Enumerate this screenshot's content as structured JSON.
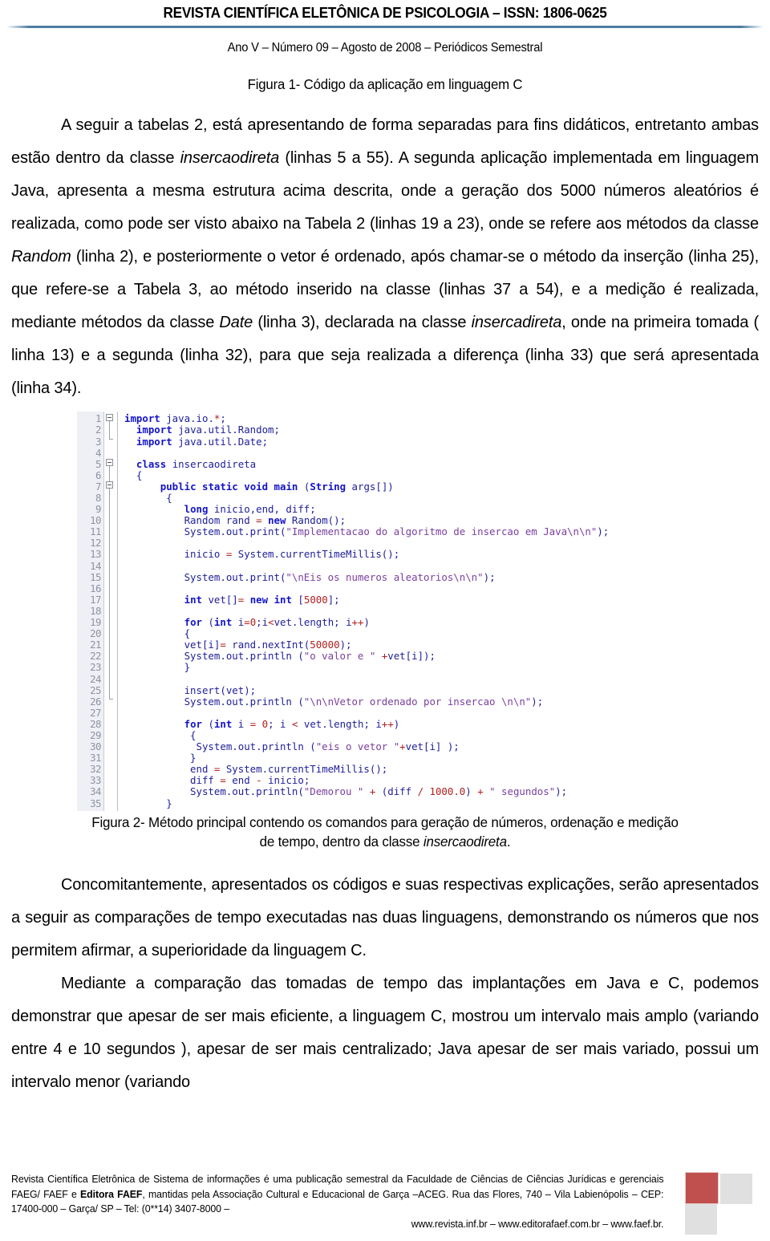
{
  "header": {
    "title": "REVISTA CIENTÍFICA ELETÔNICA DE PSICOLOGIA – ISSN: 1806-0625",
    "subtitle": "Ano V – Número 09 – Agosto  de 2008 – Periódicos Semestral",
    "rule_color": "#4c7ea1"
  },
  "figure1": {
    "caption": "Figura 1- Código da aplicação em linguagem C"
  },
  "paragraphs": {
    "p1_a": "A seguir a tabelas 2, está apresentando de forma separadas para fins didáticos, entretanto ambas estão dentro da classe ",
    "p1_i1": "insercaodireta",
    "p1_b": " (linhas 5 a 55). A segunda aplicação implementada em linguagem Java, apresenta a mesma estrutura acima descrita, onde a geração dos 5000 números aleatórios é realizada, como pode ser visto abaixo na Tabela 2  (linhas 19 a 23), onde se refere aos métodos da classe ",
    "p1_i2": "Random",
    "p1_c": " (linha 2), e posteriormente o vetor é ordenado, após chamar-se o método da inserção (linha 25), que refere-se a Tabela 3, ao método inserido na classe (linhas 37 a 54), e a medição é realizada, mediante métodos da classe ",
    "p1_i3": "Date",
    "p1_d": " (linha 3), declarada na classe ",
    "p1_i4": "insercadireta",
    "p1_e": ", onde na primeira tomada ( linha 13) e a segunda   (linha 32), para que seja realizada a diferença (linha 33)  que será apresentada (linha 34).",
    "p2": "Concomitantemente, apresentados os códigos e suas respectivas explicações, serão apresentados a seguir as comparações de tempo executadas nas duas linguagens, demonstrando os números que nos permitem afirmar, a superioridade da linguagem C.",
    "p3": "Mediante a comparação das tomadas de tempo das implantações em Java e C, podemos demonstrar que apesar de ser mais eficiente, a linguagem C, mostrou um intervalo mais amplo (variando entre 4 e 10 segundos ), apesar de ser mais centralizado; Java apesar de ser mais variado, possui um intervalo menor (variando"
  },
  "code": {
    "language": "java",
    "first_line": 1,
    "last_line": 35,
    "line_numbers": [
      "1",
      "2",
      "3",
      "4",
      "5",
      "6",
      "7",
      "8",
      "9",
      "10",
      "11",
      "12",
      "13",
      "14",
      "15",
      "16",
      "17",
      "18",
      "19",
      "20",
      "21",
      "22",
      "23",
      "24",
      "25",
      "26",
      "27",
      "28",
      "29",
      "30",
      "31",
      "32",
      "33",
      "34",
      "35"
    ],
    "lines": [
      "import java.io.*;",
      "  import java.util.Random;",
      "  import java.util.Date;",
      "",
      "  class insercaodireta",
      "  {",
      "      public static void main (String args[])",
      "       {",
      "          long inicio,end, diff;",
      "          Random rand = new Random();",
      "          System.out.print(\"Implementacao do algoritmo de insercao em Java\\n\\n\");",
      "",
      "          inicio = System.currentTimeMillis();",
      "",
      "          System.out.print(\"\\nEis os numeros aleatorios\\n\\n\");",
      "",
      "          int vet[]= new int [5000];",
      "",
      "          for (int i=0;i<vet.length; i++)",
      "          {",
      "          vet[i]= rand.nextInt(50000);",
      "          System.out.println (\"o valor e \" +vet[i]);",
      "          }",
      "",
      "          insert(vet);",
      "          System.out.println (\"\\n\\nVetor ordenado por insercao \\n\\n\");",
      "",
      "          for (int i = 0; i < vet.length; i++)",
      "           {",
      "            System.out.println (\"eis o vetor \"+vet[i] );",
      "           }",
      "           end = System.currentTimeMillis();",
      "           diff = end - inicio;",
      "           System.out.println(\"Demorou \" + (diff / 1000.0) + \" segundos\");",
      "       }"
    ]
  },
  "figure2": {
    "caption_line1": "Figura 2- Método principal contendo os comandos para geração de números, ordenação e medição",
    "caption_line2_a": "de tempo, dentro da classe ",
    "caption_line2_i": "insercaodireta",
    "caption_line2_b": "."
  },
  "footer": {
    "line1": "Revista Científica Eletrônica de Sistema de informações é uma publicação semestral da Faculdade de Ciências",
    "line2_a": "de Ciências Jurídicas e gerenciais FAEG/ FAEF e ",
    "line2_bold": "Editora FAEF",
    "line2_b": ", mantidas pela Associação Cultural e Educacional",
    "line3": "de Garça –ACEG. Rua das Flores, 740 – Vila Labienópolis – CEP: 17400-000 – Garça/ SP – Tel: (0**14) 3407-8000 –",
    "line4": "www.revista.inf.br – www.editorafaef.com.br – www.faef.br.",
    "logo_red": "#c0504d",
    "logo_gray": "#e0e0e0"
  }
}
